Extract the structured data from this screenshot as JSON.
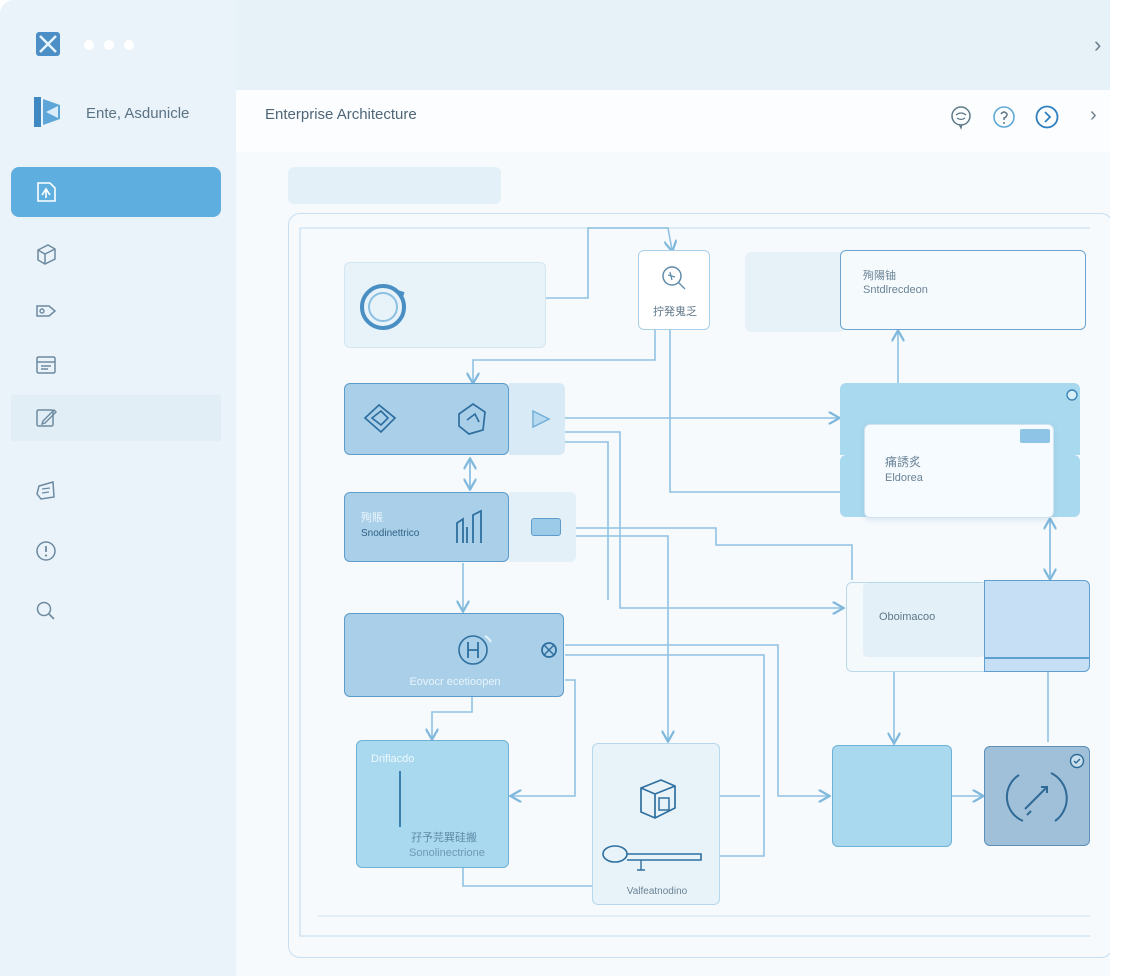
{
  "app": {
    "name": "Ente, Asdunicle",
    "page_title": "Enterprise Architecture"
  },
  "sidebar": {
    "items": [
      {
        "icon": "diagram-icon",
        "active": true
      },
      {
        "icon": "cube-icon"
      },
      {
        "icon": "tag-icon"
      },
      {
        "icon": "list-icon"
      },
      {
        "icon": "edit-icon"
      },
      {
        "icon": "message-icon"
      },
      {
        "icon": "alert-icon"
      },
      {
        "icon": "search-icon"
      }
    ]
  },
  "toolbar": {
    "icons": [
      "chat-icon",
      "help-icon",
      "next-icon"
    ]
  },
  "diagram": {
    "node_search_label": "拧発鬼乏",
    "node_tr_title": "殉陽铀",
    "node_tr_subtitle": "Sntdlrecdeon",
    "node_mid_title": "痛誘炙",
    "node_mid_subtitle": "Eldorea",
    "node_analytics_title": "殉賬",
    "node_analytics_subtitle": "Snodinettrico",
    "node_control_label": "Oboimacoo",
    "node_hub_label": "Eovocr ecetioopen",
    "node_bl_title": "Driflacdo",
    "node_bl_cjk": "孖予芫巽硅搬",
    "node_bl_subtitle": "Sonolinectrione",
    "node_package_label": "Valfeatnodino"
  },
  "colors": {
    "accent": "#5eaedf",
    "line": "#7fb8dc",
    "node_dark": "#a9cfe9",
    "node_light": "#e6f2f9"
  }
}
